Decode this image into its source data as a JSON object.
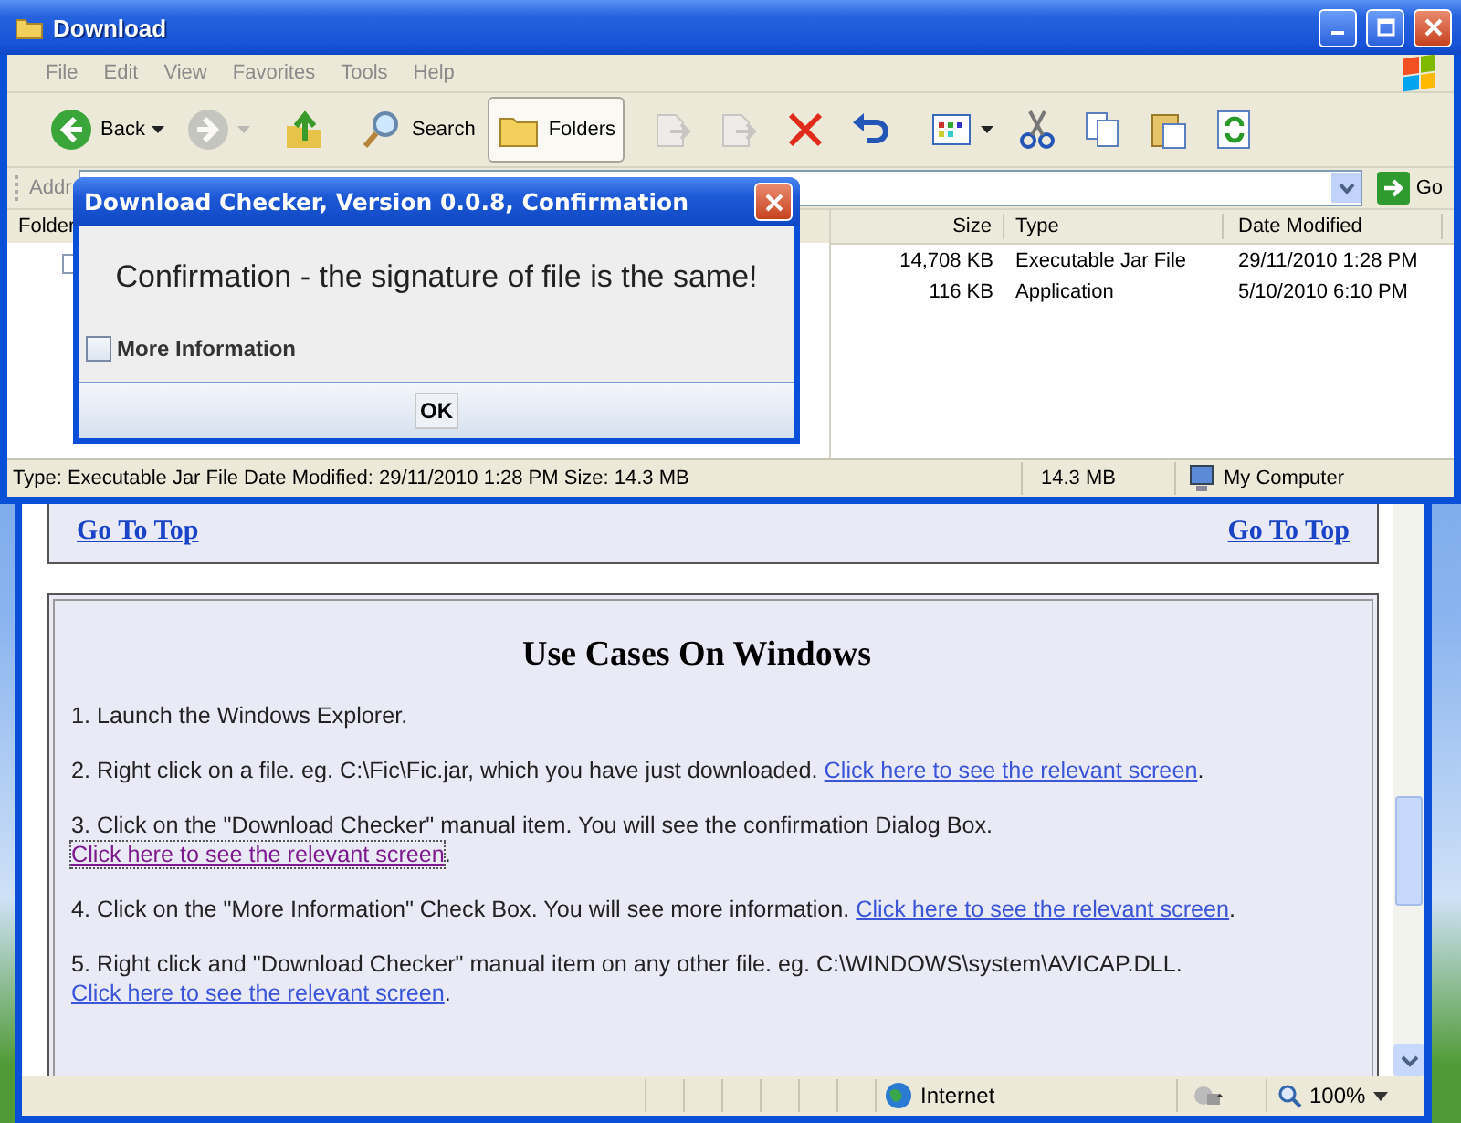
{
  "explorer": {
    "title": "Download",
    "menu": [
      "File",
      "Edit",
      "View",
      "Favorites",
      "Tools",
      "Help"
    ],
    "toolbar": [
      {
        "kind": "back",
        "label": "Back",
        "disabled": false,
        "pressed": false
      },
      {
        "kind": "forward",
        "disabled": true,
        "pressed": false
      },
      {
        "kind": "up",
        "disabled": false,
        "pressed": false
      },
      {
        "kind": "search",
        "label": "Search",
        "disabled": false,
        "pressed": false
      },
      {
        "kind": "folders",
        "label": "Folders",
        "disabled": false,
        "pressed": true
      },
      {
        "kind": "move",
        "disabled": true,
        "pressed": false
      },
      {
        "kind": "copyto",
        "disabled": true,
        "pressed": false
      },
      {
        "kind": "delete",
        "disabled": false,
        "pressed": false
      },
      {
        "kind": "undo",
        "disabled": false,
        "pressed": false
      },
      {
        "kind": "views",
        "disabled": false,
        "pressed": false
      },
      {
        "kind": "cut",
        "disabled": false,
        "pressed": false
      },
      {
        "kind": "copy",
        "disabled": false,
        "pressed": false
      },
      {
        "kind": "paste",
        "disabled": false,
        "pressed": false
      },
      {
        "kind": "sync",
        "disabled": false,
        "pressed": false
      }
    ],
    "address_label": "Addr",
    "go_label": "Go",
    "folders_label": "Folder",
    "columns": [
      "Size",
      "Type",
      "Date Modified"
    ],
    "rows": [
      {
        "size": "14,708 KB",
        "type": "Executable Jar File",
        "date": "29/11/2010 1:28 PM"
      },
      {
        "size": "116 KB",
        "type": "Application",
        "date": "5/10/2010 6:10 PM"
      }
    ],
    "status": {
      "info": "Type: Executable Jar File Date Modified: 29/11/2010 1:28 PM Size: 14.3 MB",
      "size": "14.3 MB",
      "zone": "My Computer"
    }
  },
  "dialog": {
    "title": "Download Checker, Version 0.0.8, Confirmation",
    "message": "Confirmation - the signature of file is the same!",
    "checkbox": {
      "label": "More Information",
      "checked": false
    },
    "button": "OK"
  },
  "browser": {
    "top_links": [
      "Go To Top",
      "Go To Top"
    ],
    "heading": "Use Cases On Windows",
    "steps": [
      {
        "text": "1. Launch the Windows Explorer."
      },
      {
        "text": "2. Right click on a file. eg. C:\\Fic\\Fic.jar, which you have just downloaded.",
        "link": "Click here to see the relevant screen",
        "visited": false,
        "after": "."
      },
      {
        "text": "3. Click on the \"Download Checker\" manual item. You will see the confirmation Dialog Box.",
        "link": "Click here to see the relevant screen",
        "visited": true,
        "after": "."
      },
      {
        "text": "4. Click on the \"More Information\" Check Box. You will see more information.",
        "link": "Click here to see the relevant screen",
        "visited": false,
        "after": "."
      },
      {
        "text": "5. Right click and \"Download Checker\" manual item on any other file. eg. C:\\WINDOWS\\system\\AVICAP.DLL.",
        "link": "Click here to see the relevant screen",
        "visited": false,
        "after": "."
      }
    ],
    "status": {
      "zone": "Internet",
      "zoom": "100%"
    }
  }
}
